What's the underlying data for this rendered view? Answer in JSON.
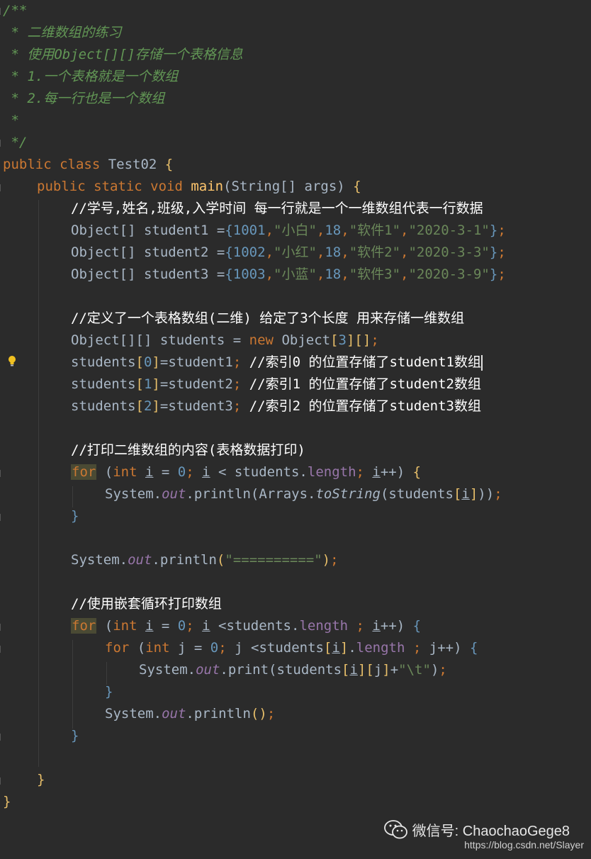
{
  "comment": {
    "l1": "/**",
    "l2": " * 二维数组的练习",
    "l3": " * 使用Object[][]存储一个表格信息",
    "l4": " * 1.一个表格就是一个数组",
    "l5": " * 2.每一行也是一个数组",
    "l6": " *",
    "l7": " */"
  },
  "code": {
    "class_kw": "public class ",
    "class_name": "Test02",
    "brace_open": " {",
    "main_kw": "public static void ",
    "main_name": "main",
    "main_params": "(String[] args) ",
    "main_brace": "{",
    "c1": "//学号,姓名,班级,入学时间 每一行就是一个一维数组代表一行数据",
    "s1_decl": "Object[] student1 =",
    "s1_vals": [
      "1001",
      "\"小白\"",
      "18",
      "\"软件1\"",
      "\"2020-3-1\""
    ],
    "s2_decl": "Object[] student2 =",
    "s2_vals": [
      "1002",
      "\"小红\"",
      "18",
      "\"软件2\"",
      "\"2020-3-3\""
    ],
    "s3_decl": "Object[] student3 =",
    "s3_vals": [
      "1003",
      "\"小蓝\"",
      "18",
      "\"软件3\"",
      "\"2020-3-9\""
    ],
    "c2": "//定义了一个表格数组(二维) 给定了3个长度 用来存储一维数组",
    "arr_decl": "Object[][] students = ",
    "arr_new": "new ",
    "arr_type": "Object",
    "arr_size": "3",
    "assign": [
      {
        "idx": "0",
        "rhs": "=student1",
        "note": "//索引0 的位置存储了student1数组"
      },
      {
        "idx": "1",
        "rhs": "=student2",
        "note": "//索引1 的位置存储了student2数组"
      },
      {
        "idx": "2",
        "rhs": "=student3",
        "note": "//索引2 的位置存储了student3数组"
      }
    ],
    "c3": "//打印二维数组的内容(表格数据打印)",
    "for1_kw": "for",
    "for1_rest_a": " (",
    "int_kw": "int",
    "var_i": "i",
    "var_j": "j",
    "zero": "0",
    "students": "students",
    "length": "length",
    "println1_a": "System.",
    "out": "out",
    "println": ".println",
    "print": ".print",
    "arrays": "Arrays.",
    "tostring": "toString",
    "sep_str": "\"==========\"",
    "c4": "//使用嵌套循环打印数组",
    "tab_str": "\"\\t\"",
    "close_brace": "}"
  },
  "watermark": {
    "text": "微信号: ChaochaoGege8",
    "url": "https://blog.csdn.net/Slayer",
    "icon": "wechat-icon"
  },
  "colors": {
    "background": "#2b2b2b",
    "keyword": "#cc7832",
    "string": "#6a8759",
    "number": "#6897bb",
    "doc_comment": "#629755",
    "method": "#ffc66d",
    "field": "#9876aa"
  }
}
